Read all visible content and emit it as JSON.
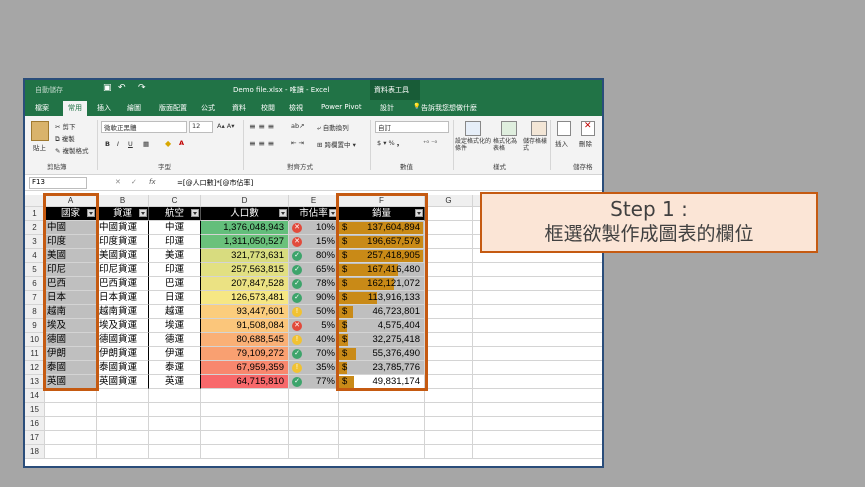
{
  "window": {
    "autosave": "自動儲存",
    "filename": "Demo file.xlsx - 唯讀 - Excel",
    "context_group": "資料表工具"
  },
  "tabs": [
    "檔案",
    "常用",
    "插入",
    "繪圖",
    "版面配置",
    "公式",
    "資料",
    "校閱",
    "檢視",
    "Power Pivot",
    "設計"
  ],
  "active_tab": "常用",
  "tell_me": "告訴我您想做什麼",
  "ribbon": {
    "paste": "貼上",
    "cut": "剪下",
    "copy": "複製",
    "format_painter": "複製格式",
    "clipboard_label": "剪貼簿",
    "font_name": "微軟正黑體",
    "font_size": "12",
    "font_label": "字型",
    "wrap_text": "自動換列",
    "merge": "跨欄置中",
    "alignment_label": "對齊方式",
    "number_format": "自訂",
    "number_label": "數值",
    "conditional_format": "設定格式化的條件",
    "format_table": "格式化為表格",
    "cell_styles": "儲存格樣式",
    "styles_label": "樣式",
    "insert": "插入",
    "delete": "刪除",
    "cells_label": "儲存格"
  },
  "formula_bar": {
    "name_box": "F13",
    "fx": "fx",
    "formula": "=[@人口數]*[@市佔率]"
  },
  "columns": [
    "A",
    "B",
    "C",
    "D",
    "E",
    "F",
    "G"
  ],
  "headers": [
    "國家",
    "貨運",
    "航空",
    "人口數",
    "市佔率",
    "銷量"
  ],
  "rows": [
    {
      "country": "中國",
      "cargo": "中國貨運",
      "air": "中運",
      "pop": "1,376,048,943",
      "share": "10%",
      "icon": "red",
      "sales_sym": "$",
      "sales": "137,604,894",
      "pop_color": "#63be7b",
      "bar": 1.0
    },
    {
      "country": "印度",
      "cargo": "印度貨運",
      "air": "印運",
      "pop": "1,311,050,527",
      "share": "15%",
      "icon": "red",
      "sales_sym": "$",
      "sales": "196,657,579",
      "pop_color": "#6ac17b",
      "bar": 1.0
    },
    {
      "country": "美國",
      "cargo": "美國貨運",
      "air": "美運",
      "pop": "321,773,631",
      "share": "80%",
      "icon": "green",
      "sales_sym": "$",
      "sales": "257,418,905",
      "pop_color": "#d8dc7f",
      "bar": 1.0
    },
    {
      "country": "印尼",
      "cargo": "印尼貨運",
      "air": "印運",
      "pop": "257,563,815",
      "share": "65%",
      "icon": "green",
      "sales_sym": "$",
      "sales": "167,416,480",
      "pop_color": "#e2e082",
      "bar": 0.7
    },
    {
      "country": "巴西",
      "cargo": "巴西貨運",
      "air": "巴運",
      "pop": "207,847,528",
      "share": "78%",
      "icon": "green",
      "sales_sym": "$",
      "sales": "162,121,072",
      "pop_color": "#ebe283",
      "bar": 0.66
    },
    {
      "country": "日本",
      "cargo": "日本貨運",
      "air": "日運",
      "pop": "126,573,481",
      "share": "90%",
      "icon": "green",
      "sales_sym": "$",
      "sales": "113,916,133",
      "pop_color": "#f6e784",
      "bar": 0.45
    },
    {
      "country": "越南",
      "cargo": "越南貨運",
      "air": "越運",
      "pop": "93,447,601",
      "share": "50%",
      "icon": "yellow",
      "sales_sym": "$",
      "sales": "46,723,801",
      "pop_color": "#fbcd7d",
      "bar": 0.17
    },
    {
      "country": "埃及",
      "cargo": "埃及貨運",
      "air": "埃運",
      "pop": "91,508,084",
      "share": "5%",
      "icon": "red",
      "sales_sym": "$",
      "sales": "4,575,404",
      "pop_color": "#fbc67b",
      "bar": 0.015
    },
    {
      "country": "德國",
      "cargo": "德國貨運",
      "air": "德運",
      "pop": "80,688,545",
      "share": "40%",
      "icon": "yellow",
      "sales_sym": "$",
      "sales": "32,275,418",
      "pop_color": "#fab076",
      "bar": 0.11
    },
    {
      "country": "伊朗",
      "cargo": "伊朗貨運",
      "air": "伊運",
      "pop": "79,109,272",
      "share": "70%",
      "icon": "green",
      "sales_sym": "$",
      "sales": "55,376,490",
      "pop_color": "#f9a071",
      "bar": 0.2
    },
    {
      "country": "泰國",
      "cargo": "泰國貨運",
      "air": "泰運",
      "pop": "67,959,359",
      "share": "35%",
      "icon": "yellow",
      "sales_sym": "$",
      "sales": "23,785,776",
      "pop_color": "#f8876e",
      "bar": 0.08
    },
    {
      "country": "英國",
      "cargo": "英國貨運",
      "air": "英運",
      "pop": "64,715,810",
      "share": "77%",
      "icon": "green",
      "sales_sym": "$",
      "sales": "49,831,174",
      "pop_color": "#f8696b",
      "bar": 0.18
    }
  ],
  "row_numbers": [
    "1",
    "2",
    "3",
    "4",
    "5",
    "6",
    "7",
    "8",
    "9",
    "10",
    "11",
    "12",
    "13",
    "14",
    "15",
    "16",
    "17",
    "18"
  ],
  "callout": {
    "line1": "Step 1 :",
    "line2": "框選欲製作成圖表的欄位"
  },
  "colors": {
    "excel_green": "#217346",
    "highlight": "#c55a11",
    "callout_fill": "#fbe5d6"
  }
}
